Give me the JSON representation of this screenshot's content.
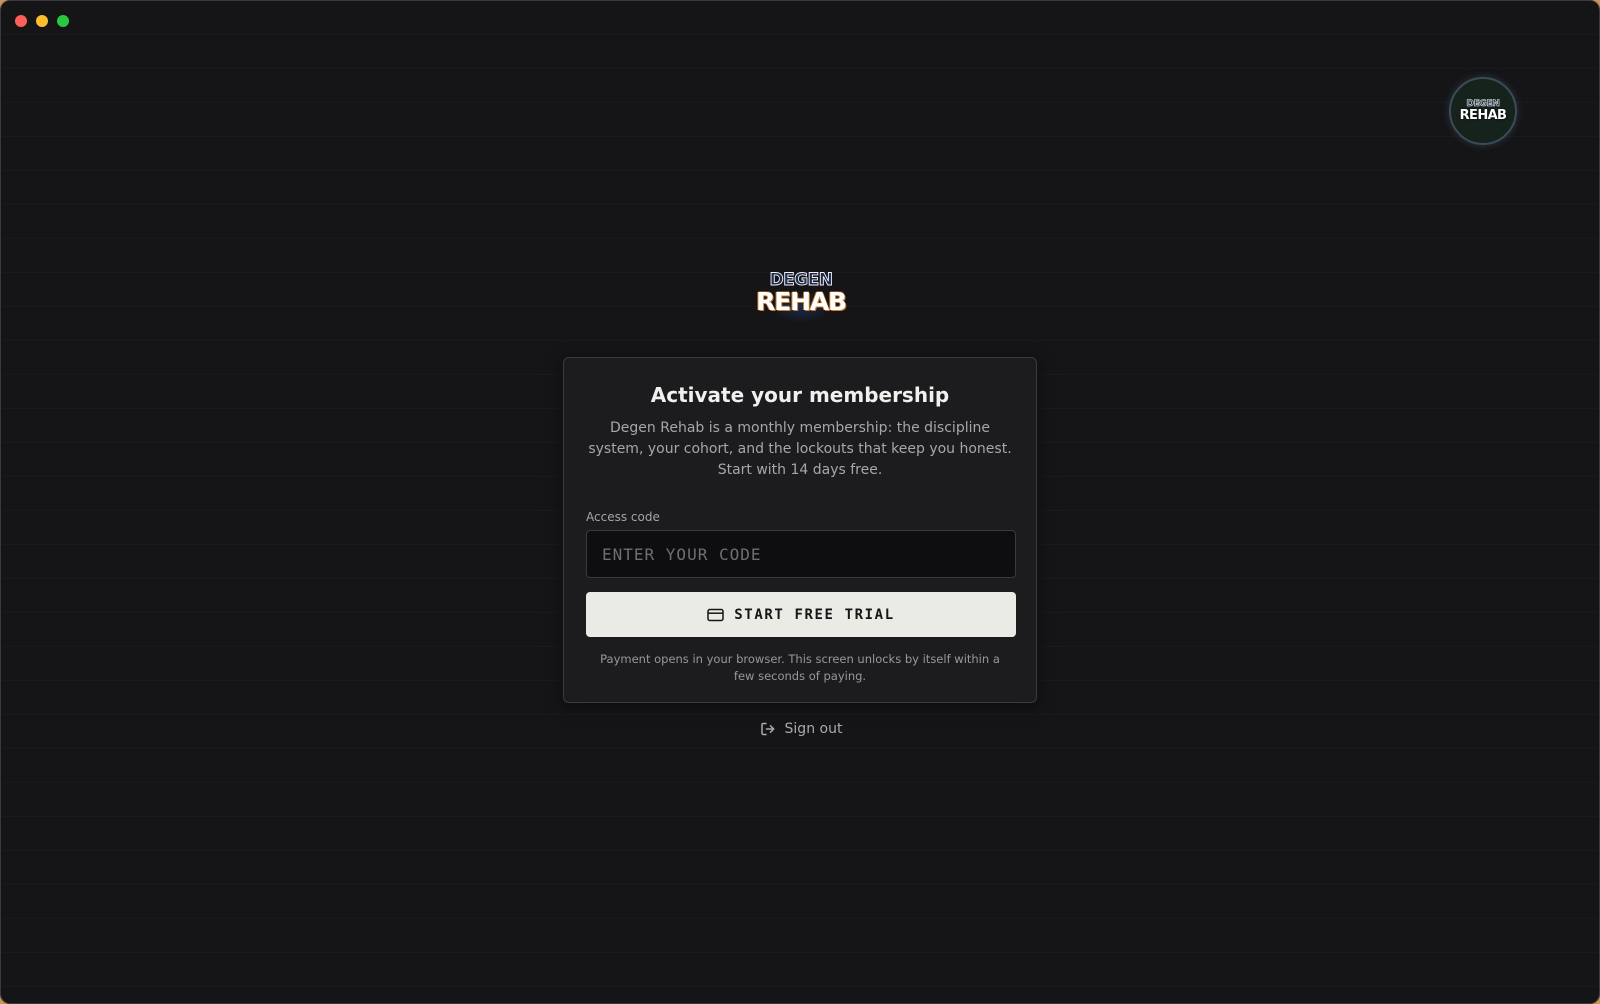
{
  "window": {
    "controls": [
      "close",
      "minimize",
      "maximize"
    ]
  },
  "avatar": {
    "line1": "DEGEN",
    "line2": "REHAB"
  },
  "logo": {
    "line1": "DEGEN",
    "line2": "REHAB"
  },
  "card": {
    "title": "Activate your membership",
    "description": "Degen Rehab is a monthly membership: the discipline system, your cohort, and the lockouts that keep you honest. Start with 14 days free.",
    "access_code": {
      "label": "Access code",
      "value": "",
      "placeholder": "ENTER YOUR CODE"
    },
    "cta": {
      "icon": "credit-card-icon",
      "label": "START FREE TRIAL"
    },
    "note": "Payment opens in your browser. This screen unlocks by itself within a few seconds of paying."
  },
  "signout": {
    "icon": "logout-icon",
    "label": "Sign out"
  },
  "colors": {
    "background": "#151517",
    "card": "#1c1c1e",
    "cta_bg": "#ebebe6",
    "cta_text": "#161618",
    "input_bg": "#0e0e10"
  }
}
